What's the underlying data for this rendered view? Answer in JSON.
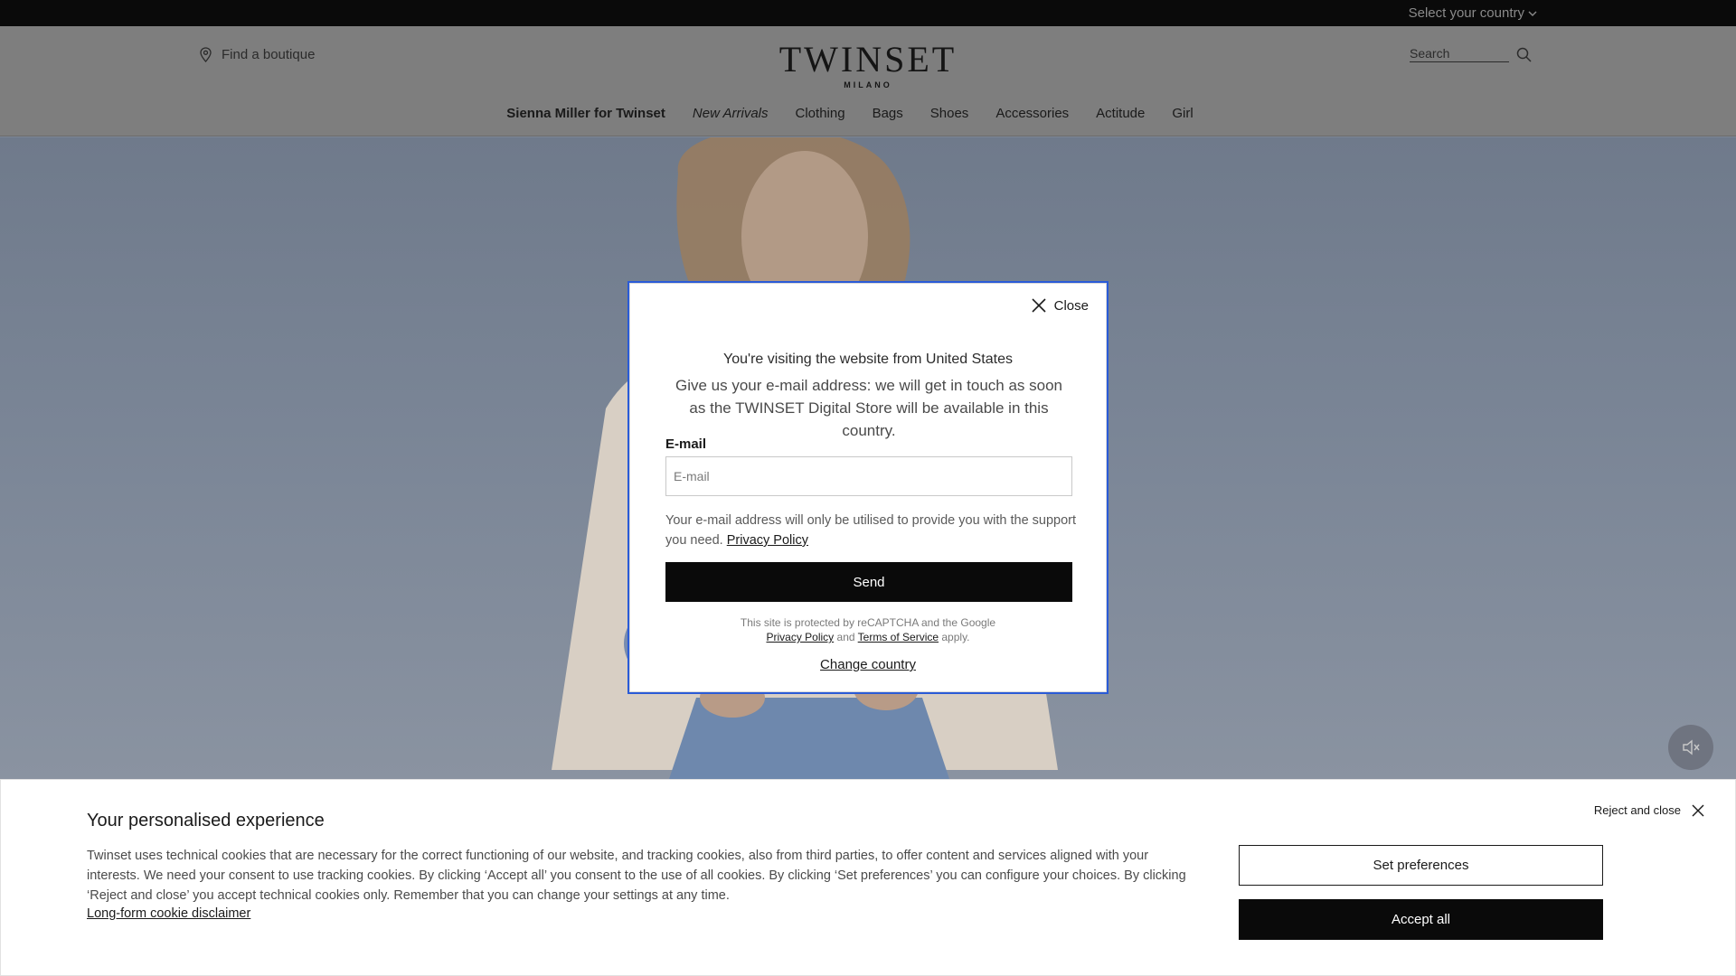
{
  "topbar": {
    "country_select": "Select your country"
  },
  "header": {
    "find_boutique": "Find a boutique",
    "logo_main": "TWINSET",
    "logo_sub": "MILANO",
    "search_placeholder": "Search"
  },
  "nav": {
    "items": [
      {
        "label": "Sienna Miller for Twinset"
      },
      {
        "label": "New Arrivals"
      },
      {
        "label": "Clothing"
      },
      {
        "label": "Bags"
      },
      {
        "label": "Shoes"
      },
      {
        "label": "Accessories"
      },
      {
        "label": "Actitude"
      },
      {
        "label": "Girl"
      }
    ]
  },
  "modal": {
    "close_label": "Close",
    "title": "You're visiting the website from United States",
    "text": "Give us your e-mail address: we will get in touch as soon as the TWINSET Digital Store will be available in this country.",
    "email_label": "E-mail",
    "email_placeholder": "E-mail",
    "consent_text": "Your e-mail address will only be utilised to provide you with the support you need.",
    "privacy_link": "Privacy Policy",
    "send_label": "Send",
    "recaptcha_text": "This site is protected by reCAPTCHA and the Google",
    "recaptcha_privacy": "Privacy Policy",
    "recaptcha_and": "and",
    "recaptcha_terms": "Terms of Service",
    "recaptcha_apply": "apply.",
    "change_country": "Change country"
  },
  "cookie": {
    "title": "Your personalised experience",
    "text": "Twinset uses technical cookies that are necessary for the correct functioning of our website, and tracking cookies, also from third parties, to offer content and services aligned with your interests. We need your consent to use tracking cookies. By clicking ‘Accept all’ you consent to the use of all cookies. By clicking ‘Set preferences’ you can configure your choices. By clicking ‘Reject and close’ you accept technical cookies only. Remember that you can change your settings at any time.",
    "disclaimer_link": "Long-form cookie disclaimer",
    "reject_label": "Reject and close",
    "preferences_label": "Set preferences",
    "accept_label": "Accept all"
  },
  "icons": {
    "location": "location-pin-icon",
    "search": "search-icon",
    "close": "close-icon",
    "mute": "speaker-muted-icon",
    "chevron": "chevron-down-icon"
  }
}
